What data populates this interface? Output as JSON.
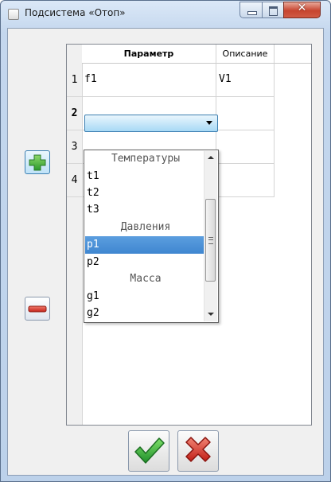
{
  "window": {
    "title": "Подсистема «Отоп»",
    "controls": {
      "minimize_icon": "minimize-icon",
      "maximize_icon": "maximize-icon",
      "close_icon": "close-icon"
    }
  },
  "grid": {
    "columns": [
      "Параметр",
      "Описание"
    ],
    "rows": [
      {
        "num": "1",
        "param": "f1",
        "desc": "V1"
      },
      {
        "num": "2",
        "param": "",
        "desc": ""
      },
      {
        "num": "3",
        "param": "",
        "desc": ""
      },
      {
        "num": "4",
        "param": "",
        "desc": ""
      }
    ]
  },
  "dropdown": {
    "items": [
      {
        "label": "Температуры",
        "group": true
      },
      {
        "label": "t1"
      },
      {
        "label": "t2"
      },
      {
        "label": "t3"
      },
      {
        "label": "Давления",
        "group": true
      },
      {
        "label": "p1",
        "selected": true
      },
      {
        "label": "p2"
      },
      {
        "label": "Масса",
        "group": true
      },
      {
        "label": "g1"
      },
      {
        "label": "g2"
      }
    ]
  },
  "buttons": {
    "add_icon": "plus-icon",
    "remove_icon": "minus-icon",
    "ok_icon": "checkmark-icon",
    "cancel_icon": "x-icon"
  },
  "colors": {
    "accent_green": "#2fa82f",
    "accent_red": "#d42b22",
    "selection": "#3f86d0"
  }
}
